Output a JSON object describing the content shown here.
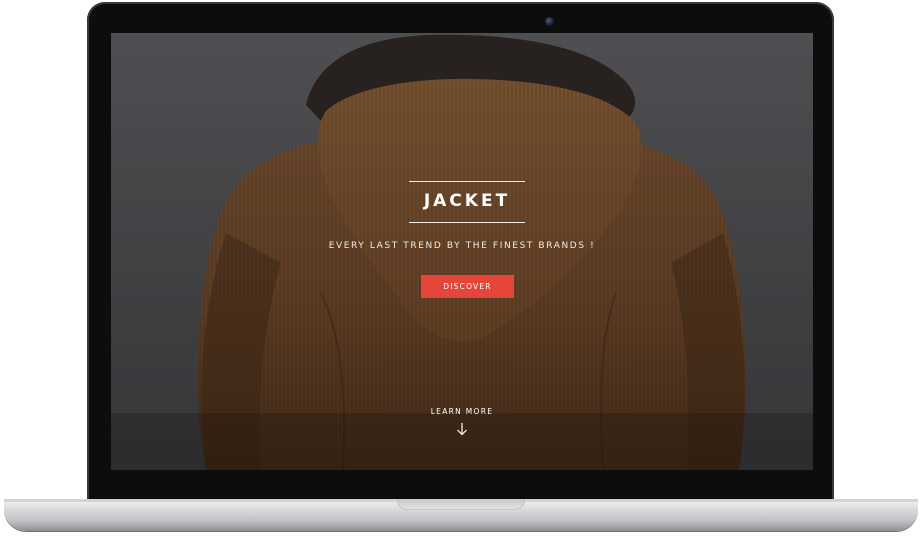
{
  "hero": {
    "title": "JACKET",
    "tagline": "EVERY LAST TREND BY THE FINEST BRANDS !",
    "cta_label": "DISCOVER",
    "learn_more_label": "LEARN MORE"
  },
  "icons": {
    "scroll": "arrow-down-icon",
    "camera": "camera-icon"
  },
  "colors": {
    "accent": "#e4473a",
    "text": "#ffffff",
    "jacket": "#6b4426",
    "backdrop": "#56565a"
  }
}
